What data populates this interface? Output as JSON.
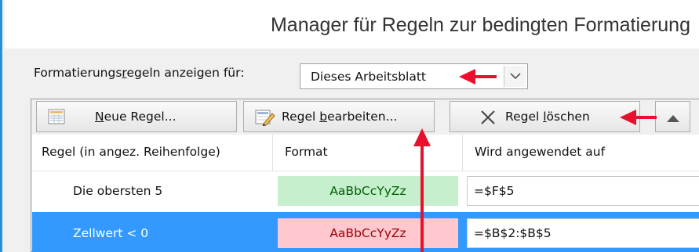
{
  "window": {
    "title": "Manager für Regeln zur bedingten Formatierung"
  },
  "show_rules": {
    "label_before": "Formatierungs",
    "label_mnemonic": "r",
    "label_after": "egeln anzeigen für:",
    "selected": "Dieses Arbeitsblatt"
  },
  "toolbar": {
    "new_rule": {
      "mnemonic": "N",
      "rest": "eue Regel..."
    },
    "edit_rule": {
      "before": "Regel ",
      "mnemonic": "b",
      "rest": "earbeiten..."
    },
    "delete_rule": {
      "before": "Regel ",
      "mnemonic": "l",
      "rest": "öschen"
    }
  },
  "table": {
    "headers": [
      "Regel (in angez. Reihenfolge)",
      "Format",
      "Wird angewendet auf"
    ],
    "rows": [
      {
        "rule": "Die obersten 5",
        "preview": "AaBbCcYyZz",
        "applies_to": "=$F$5",
        "preview_bg": "#c6efce",
        "preview_fg": "#006100",
        "selected": false
      },
      {
        "rule": "Zellwert < 0",
        "preview": "AaBbCcYyZz",
        "applies_to": "=$B$2:$B$5",
        "preview_bg": "#ffc7ce",
        "preview_fg": "#9c0006",
        "selected": true
      }
    ]
  },
  "colors": {
    "accent": "#2b8fd7",
    "selection": "#3399ff",
    "annotation_arrow": "#e8112d"
  }
}
